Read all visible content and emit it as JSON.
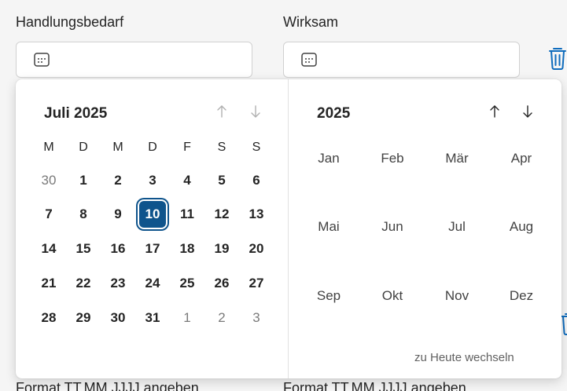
{
  "fields": {
    "left_label": "Handlungsbedarf",
    "right_label": "Wirksam",
    "left_hint": "Format TT.MM.JJJJ angeben",
    "right_hint": "Format TT.MM.JJJJ angeben"
  },
  "day_picker": {
    "title": "Juli 2025",
    "weekdays": [
      "M",
      "D",
      "M",
      "D",
      "F",
      "S",
      "S"
    ],
    "weeks": [
      [
        {
          "d": "30",
          "muted": true
        },
        {
          "d": "1"
        },
        {
          "d": "2"
        },
        {
          "d": "3"
        },
        {
          "d": "4"
        },
        {
          "d": "5"
        },
        {
          "d": "6"
        }
      ],
      [
        {
          "d": "7"
        },
        {
          "d": "8"
        },
        {
          "d": "9"
        },
        {
          "d": "10",
          "selected": true
        },
        {
          "d": "11"
        },
        {
          "d": "12"
        },
        {
          "d": "13"
        }
      ],
      [
        {
          "d": "14"
        },
        {
          "d": "15"
        },
        {
          "d": "16"
        },
        {
          "d": "17"
        },
        {
          "d": "18"
        },
        {
          "d": "19"
        },
        {
          "d": "20"
        }
      ],
      [
        {
          "d": "21"
        },
        {
          "d": "22"
        },
        {
          "d": "23"
        },
        {
          "d": "24"
        },
        {
          "d": "25"
        },
        {
          "d": "26"
        },
        {
          "d": "27"
        }
      ],
      [
        {
          "d": "28"
        },
        {
          "d": "29"
        },
        {
          "d": "30"
        },
        {
          "d": "31"
        },
        {
          "d": "1",
          "muted": true
        },
        {
          "d": "2",
          "muted": true
        },
        {
          "d": "3",
          "muted": true
        }
      ]
    ]
  },
  "month_picker": {
    "title": "2025",
    "months": [
      "Jan",
      "Feb",
      "Mär",
      "Apr",
      "Mai",
      "Jun",
      "Jul",
      "Aug",
      "Sep",
      "Okt",
      "Nov",
      "Dez"
    ],
    "today_link": "zu Heute wechseln"
  },
  "icons": {
    "calendar": "calendar-icon",
    "trash": "trash-icon",
    "up": "arrow-up-icon",
    "down": "arrow-down-icon"
  },
  "colors": {
    "selected": "#0f548c",
    "trash": "#0f6cbd",
    "page_bg": "#f5f5f5"
  }
}
